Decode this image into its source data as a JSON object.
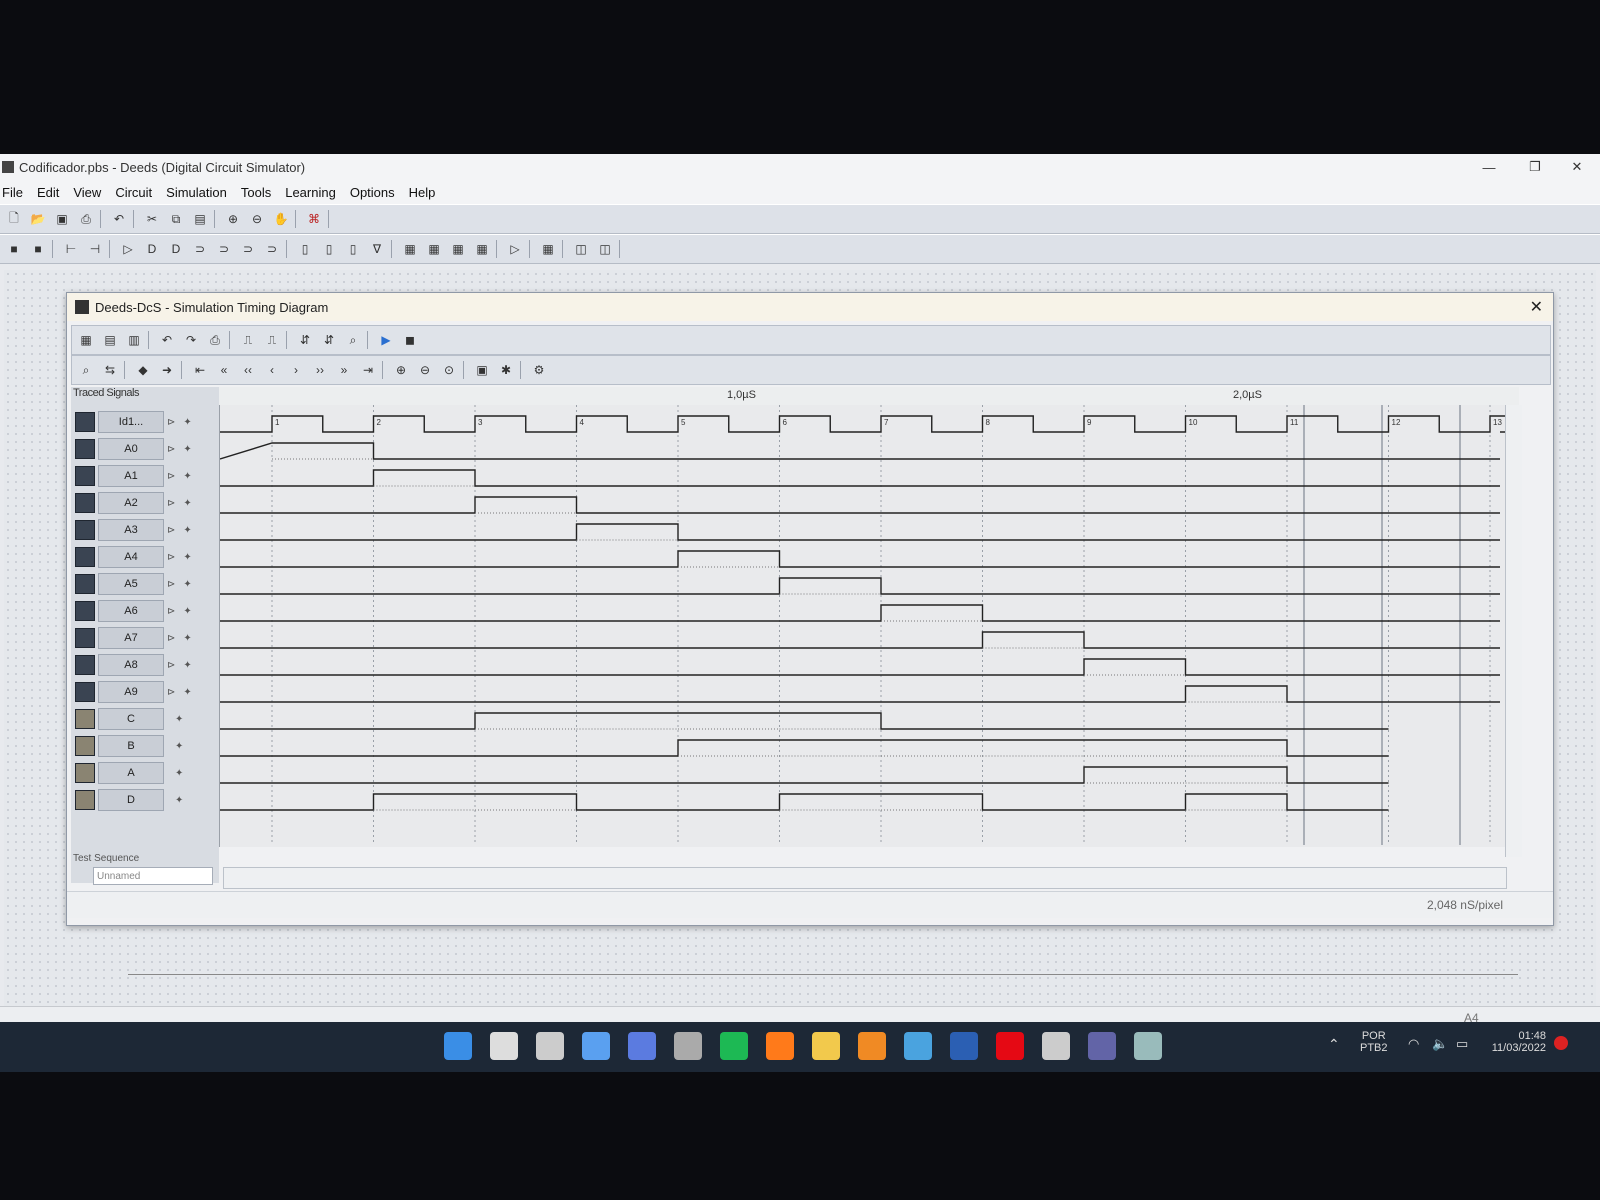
{
  "window": {
    "title": "Codificador.pbs - Deeds (Digital Circuit Simulator)",
    "minimize": "—",
    "maximize": "❐",
    "close": "✕"
  },
  "menu": [
    "File",
    "Edit",
    "View",
    "Circuit",
    "Simulation",
    "Tools",
    "Learning",
    "Options",
    "Help"
  ],
  "dialog": {
    "title": "Deeds-DcS  -  Simulation Timing Diagram",
    "close": "✕",
    "traced_label": "Traced Signals",
    "time_marks": [
      "1,0µS",
      "2,0µS"
    ],
    "test_sequence_label": "Test Sequence",
    "test_sequence_value": "Unnamed",
    "status_scale": "2,048 nS/pixel"
  },
  "signals": [
    {
      "name": "Id1...",
      "kind": "clock",
      "icon": "clock-icon"
    },
    {
      "name": "A0",
      "kind": "in",
      "icon": "switch-icon"
    },
    {
      "name": "A1",
      "kind": "in",
      "icon": "switch-icon"
    },
    {
      "name": "A2",
      "kind": "in",
      "icon": "switch-icon"
    },
    {
      "name": "A3",
      "kind": "in",
      "icon": "switch-icon"
    },
    {
      "name": "A4",
      "kind": "in",
      "icon": "switch-icon"
    },
    {
      "name": "A5",
      "kind": "in",
      "icon": "switch-icon"
    },
    {
      "name": "A6",
      "kind": "in",
      "icon": "switch-icon"
    },
    {
      "name": "A7",
      "kind": "in",
      "icon": "switch-icon"
    },
    {
      "name": "A8",
      "kind": "in",
      "icon": "switch-icon"
    },
    {
      "name": "A9",
      "kind": "in",
      "icon": "switch-icon"
    },
    {
      "name": "C",
      "kind": "out",
      "icon": "led-icon"
    },
    {
      "name": "B",
      "kind": "out",
      "icon": "led-icon"
    },
    {
      "name": "A",
      "kind": "out",
      "icon": "led-icon"
    },
    {
      "name": "D",
      "kind": "out",
      "icon": "led-icon"
    }
  ],
  "clock_numbers": [
    "1",
    "2",
    "3",
    "4",
    "5",
    "6",
    "7",
    "8",
    "9",
    "10",
    "11",
    "12",
    "13"
  ],
  "waveforms": {
    "A0": [
      1
    ],
    "A1": [
      2
    ],
    "A2": [
      3
    ],
    "A3": [
      4
    ],
    "A4": [
      5
    ],
    "A5": [
      6
    ],
    "A6": [
      7
    ],
    "A7": [
      8
    ],
    "A8": [
      9
    ],
    "A9": [
      10
    ],
    "C": [
      3,
      4,
      5,
      6
    ],
    "B": [
      5,
      6,
      7,
      8,
      9,
      10
    ],
    "A": [
      9,
      10
    ],
    "D": [
      2,
      3,
      6,
      7,
      10
    ]
  },
  "statusbar": {
    "page": "A4"
  },
  "taskbar": {
    "lang": "POR",
    "lang2": "PTB2",
    "time": "01:48",
    "date": "11/03/2022",
    "icons": [
      "windows-start-icon",
      "search-icon",
      "task-view-icon",
      "widgets-icon",
      "chat-icon",
      "terminal-icon",
      "spotify-icon",
      "firefox-icon",
      "file-explorer-icon",
      "sublime-icon",
      "mail-icon",
      "word-icon",
      "netflix-icon",
      "snipping-icon",
      "teams-icon",
      "deeds-icon"
    ]
  }
}
